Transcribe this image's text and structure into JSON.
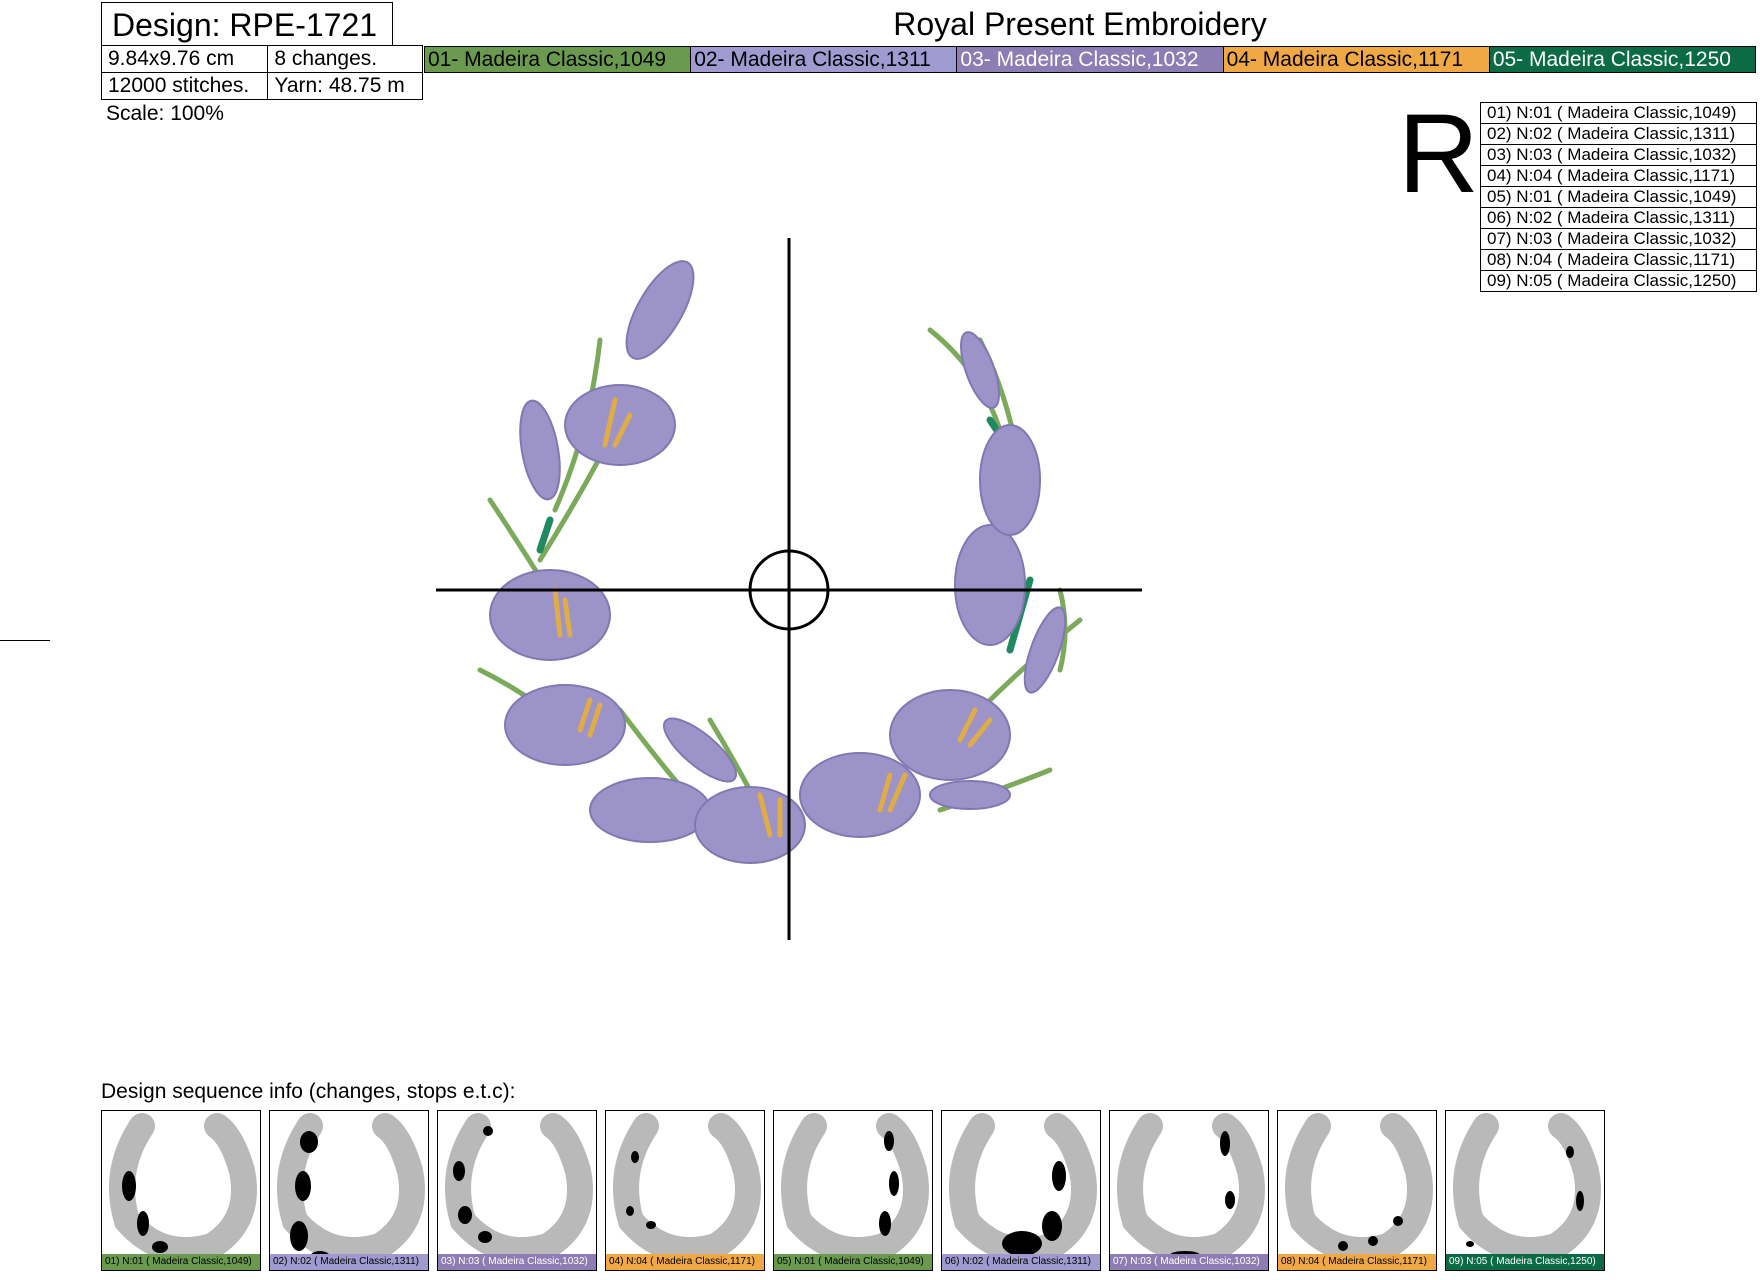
{
  "design_label": "Design: RPE-1721",
  "size": "9.84x9.76 cm",
  "changes": "8 changes.",
  "stitches": "12000 stitches.",
  "yarn": "Yarn: 48.75 m",
  "scale": "Scale: 100%",
  "company": "Royal Present Embroidery",
  "rotation_mark": "R",
  "colors": [
    {
      "label": "01- Madeira Classic,1049",
      "bg": "#6a9a4e",
      "fg": "#000000"
    },
    {
      "label": "02- Madeira Classic,1311",
      "bg": "#9f9bd0",
      "fg": "#000000"
    },
    {
      "label": "03- Madeira Classic,1032",
      "bg": "#8e7cb4",
      "fg": "#ffffff"
    },
    {
      "label": "04- Madeira Classic,1171",
      "bg": "#f0a845",
      "fg": "#000000"
    },
    {
      "label": "05- Madeira Classic,1250",
      "bg": "#0b6b45",
      "fg": "#ffffff"
    }
  ],
  "sequence": [
    "01) N:01 ( Madeira Classic,1049)",
    "02) N:02 ( Madeira Classic,1311)",
    "03) N:03 ( Madeira Classic,1032)",
    "04) N:04 ( Madeira Classic,1171)",
    "05) N:01 ( Madeira Classic,1049)",
    "06) N:02 ( Madeira Classic,1311)",
    "07) N:03 ( Madeira Classic,1032)",
    "08) N:04 ( Madeira Classic,1171)",
    "09) N:05 ( Madeira Classic,1250)"
  ],
  "sequence_heading": "Design sequence info (changes, stops e.t.c):",
  "thumbnails": [
    {
      "label": "01) N:01 ( Madeira Classic,1049)",
      "bg": "#6a9a4e",
      "fg": "#000000"
    },
    {
      "label": "02) N:02 ( Madeira Classic,1311)",
      "bg": "#9f9bd0",
      "fg": "#000000"
    },
    {
      "label": "03) N:03 ( Madeira Classic,1032)",
      "bg": "#8e7cb4",
      "fg": "#ffffff"
    },
    {
      "label": "04) N:04 ( Madeira Classic,1171)",
      "bg": "#f0a845",
      "fg": "#000000"
    },
    {
      "label": "05) N:01 ( Madeira Classic,1049)",
      "bg": "#6a9a4e",
      "fg": "#000000"
    },
    {
      "label": "06) N:02 ( Madeira Classic,1311)",
      "bg": "#9f9bd0",
      "fg": "#000000"
    },
    {
      "label": "07) N:03 ( Madeira Classic,1032)",
      "bg": "#8e7cb4",
      "fg": "#ffffff"
    },
    {
      "label": "08) N:04 ( Madeira Classic,1171)",
      "bg": "#f0a845",
      "fg": "#000000"
    },
    {
      "label": "09) N:05 ( Madeira Classic,1250)",
      "bg": "#0b6b45",
      "fg": "#ffffff"
    }
  ]
}
